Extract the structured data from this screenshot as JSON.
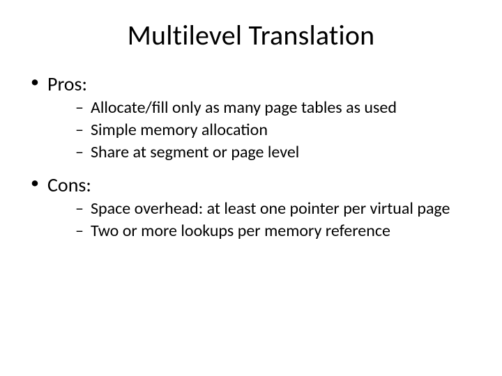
{
  "title": "Multilevel Translation",
  "bullets": [
    {
      "label": "Pros:",
      "sub": [
        "Allocate/fill only as many page tables as used",
        "Simple memory allocation",
        "Share at segment or page level"
      ]
    },
    {
      "label": "Cons:",
      "sub": [
        "Space overhead: at least one pointer per virtual page",
        "Two or more lookups per memory reference"
      ]
    }
  ]
}
